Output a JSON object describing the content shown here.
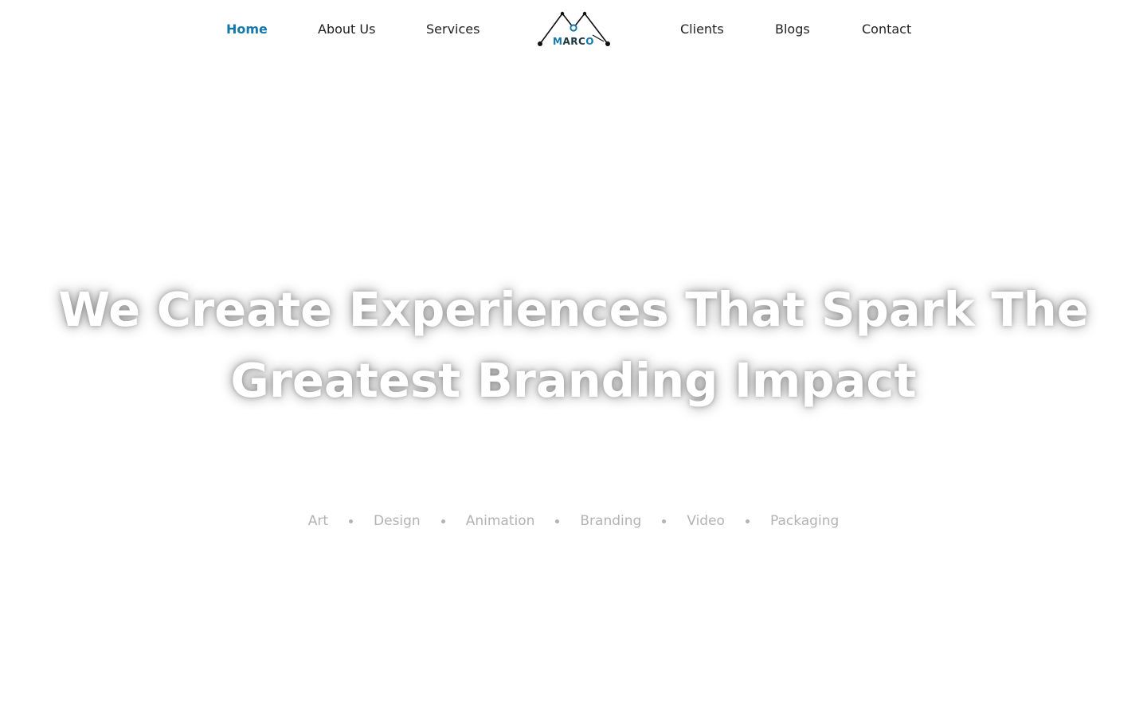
{
  "nav": {
    "left": [
      {
        "label": "Home",
        "active": true
      },
      {
        "label": "About Us",
        "active": false
      },
      {
        "label": "Services",
        "active": false
      }
    ],
    "right": [
      {
        "label": "Clients",
        "active": false
      },
      {
        "label": "Blogs",
        "active": false
      },
      {
        "label": "Contact",
        "active": false
      }
    ],
    "logo": {
      "text": "MARCO",
      "accent_letters": "M O",
      "icon": "mountain-peaks-logo-icon"
    }
  },
  "hero": {
    "title_line1": "We Create Experiences That Spark The",
    "title_line2": "Greatest Branding Impact"
  },
  "tags": [
    "Art",
    "Design",
    "Animation",
    "Branding",
    "Video",
    "Packaging"
  ],
  "colors": {
    "accent": "#1479a9",
    "nav_text": "#1f1f1f",
    "tag_text": "#b3b3b3",
    "hero_text": "#ffffff"
  }
}
